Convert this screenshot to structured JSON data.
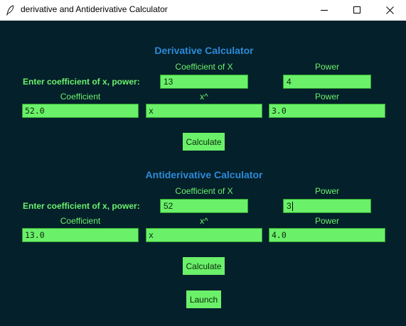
{
  "window": {
    "title": "derivative and Antiderivative Calculator",
    "icon": "feather-icon",
    "minimize_icon": "minimize-icon",
    "maximize_icon": "maximize-icon",
    "close_icon": "close-icon"
  },
  "colors": {
    "background": "#04202a",
    "heading": "#2d8ad8",
    "label": "#6cf06c",
    "field": "#6bf06a"
  },
  "derivative": {
    "heading": "Derivative Calculator",
    "prompt": "Enter coefficient of x, power:",
    "coef_x_header": "Coefficient of X",
    "power_header": "Power",
    "coef_input": "13",
    "power_input": "4",
    "result_coef_header": "Coefficient",
    "result_x_header": "x^",
    "result_power_header": "Power",
    "result_coef": "52.0",
    "result_x": "x",
    "result_power": "3.0",
    "calculate_label": "Calculate"
  },
  "antiderivative": {
    "heading": "Antiderivative Calculator",
    "prompt": "Enter coefficient of x, power:",
    "coef_x_header": "Coefficient of X",
    "power_header": "Power",
    "coef_input": "52",
    "power_input": "3",
    "result_coef_header": "Coefficient",
    "result_x_header": "x^",
    "result_power_header": "Power",
    "result_coef": "13.0",
    "result_x": "x",
    "result_power": "4.0",
    "calculate_label": "Calculate"
  },
  "launch_label": "Launch"
}
